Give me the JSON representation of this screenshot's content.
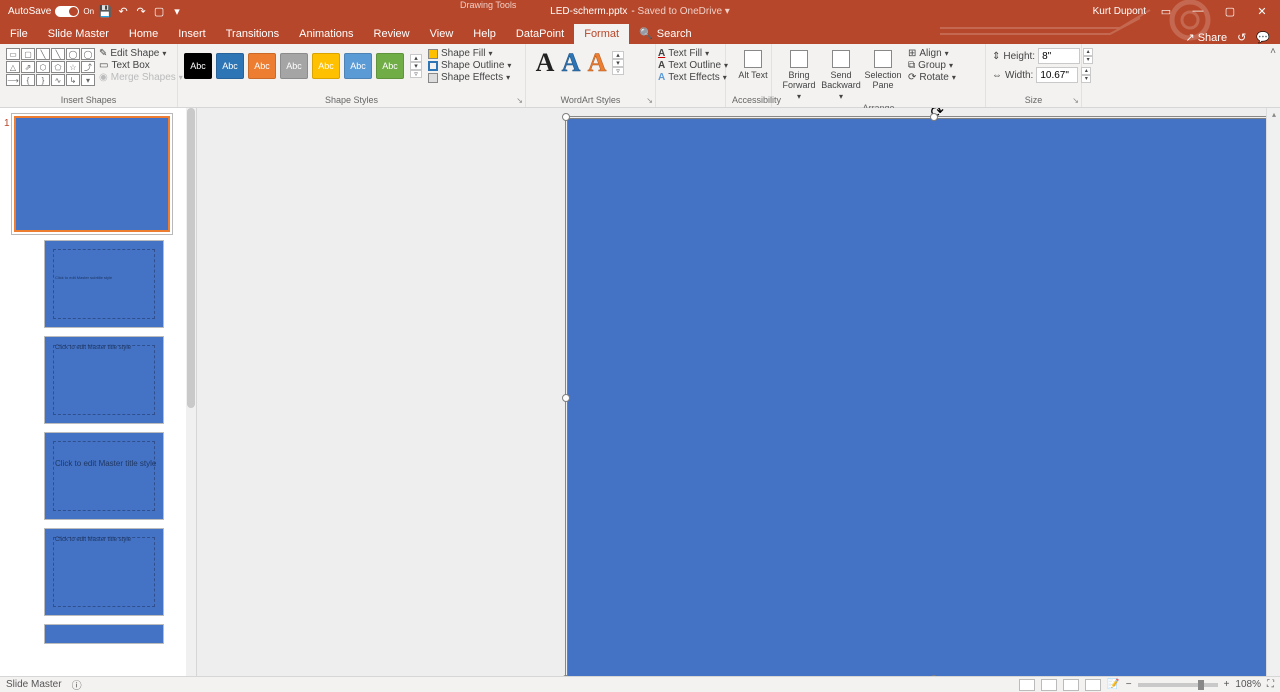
{
  "titlebar": {
    "autosave": "AutoSave",
    "autosave_state": "On",
    "drawing_tools": "Drawing Tools",
    "document": "LED-scherm.pptx",
    "saved": "Saved to OneDrive",
    "user": "Kurt Dupont"
  },
  "menu": {
    "file": "File",
    "slide_master": "Slide Master",
    "home": "Home",
    "insert": "Insert",
    "transitions": "Transitions",
    "animations": "Animations",
    "review": "Review",
    "view": "View",
    "help": "Help",
    "datapoint": "DataPoint",
    "format": "Format",
    "search": "Search",
    "share": "Share"
  },
  "ribbon": {
    "insert_shapes": {
      "label": "Insert Shapes",
      "edit_shape": "Edit Shape",
      "text_box": "Text Box",
      "merge_shapes": "Merge Shapes"
    },
    "shape_styles": {
      "label": "Shape Styles",
      "swatch_text": "Abc",
      "colors": [
        "#000000",
        "#2e75b6",
        "#ed7d31",
        "#a5a5a5",
        "#ffc000",
        "#5b9bd5",
        "#70ad47"
      ],
      "shape_fill": "Shape Fill",
      "shape_outline": "Shape Outline",
      "shape_effects": "Shape Effects"
    },
    "wordart": {
      "label": "WordArt Styles",
      "text_fill": "Text Fill",
      "text_outline": "Text Outline",
      "text_effects": "Text Effects"
    },
    "accessibility": {
      "label": "Accessibility",
      "alt_text": "Alt\nText"
    },
    "arrange": {
      "label": "Arrange",
      "bring_forward": "Bring\nForward",
      "send_backward": "Send\nBackward",
      "selection_pane": "Selection\nPane",
      "align": "Align",
      "group": "Group",
      "rotate": "Rotate"
    },
    "size": {
      "label": "Size",
      "height_lbl": "Height:",
      "height_val": "8\"",
      "width_lbl": "Width:",
      "width_val": "10.67\""
    }
  },
  "thumbs": {
    "master_number": "1",
    "layout2_title": "Click to edit Master title style",
    "layout3_title": "Click to edit Master title\nstyle",
    "layout4_title": "Click to edit Master title style"
  },
  "status": {
    "mode": "Slide Master",
    "zoom": "108%"
  }
}
